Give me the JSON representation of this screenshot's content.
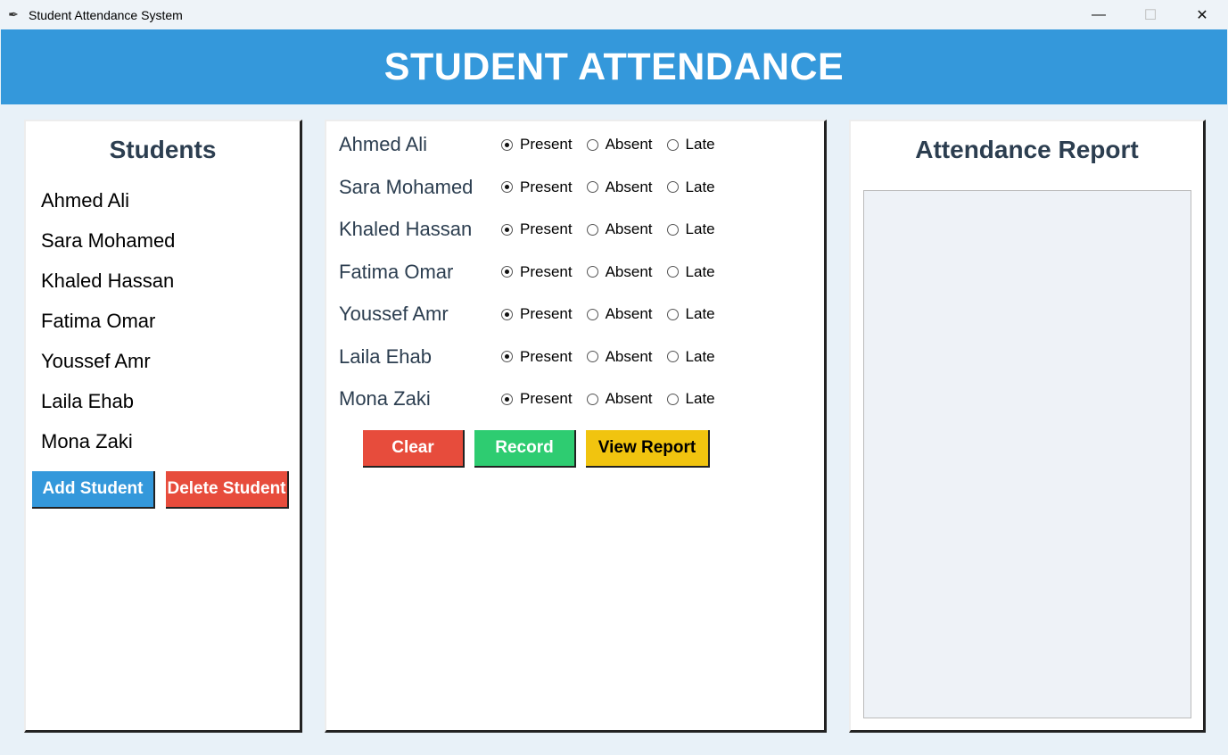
{
  "window": {
    "title": "Student Attendance System",
    "app_icon": "feather-icon",
    "controls": {
      "minimize": "—",
      "maximize": "☐",
      "close": "✕"
    }
  },
  "header": {
    "title": "STUDENT ATTENDANCE"
  },
  "students_panel": {
    "heading": "Students",
    "students": [
      "Ahmed Ali",
      "Sara Mohamed",
      "Khaled Hassan",
      "Fatima Omar",
      "Youssef Amr",
      "Laila Ehab",
      "Mona Zaki"
    ],
    "add_button": "Add Student",
    "delete_button": "Delete Student"
  },
  "attendance_panel": {
    "options": [
      "Present",
      "Absent",
      "Late"
    ],
    "rows": [
      {
        "name": "Ahmed Ali",
        "selected": "Present"
      },
      {
        "name": "Sara Mohamed",
        "selected": "Present"
      },
      {
        "name": "Khaled Hassan",
        "selected": "Present"
      },
      {
        "name": "Fatima Omar",
        "selected": "Present"
      },
      {
        "name": "Youssef Amr",
        "selected": "Present"
      },
      {
        "name": "Laila Ehab",
        "selected": "Present"
      },
      {
        "name": "Mona Zaki",
        "selected": "Present"
      }
    ],
    "clear_button": "Clear",
    "record_button": "Record",
    "view_report_button": "View Report"
  },
  "report_panel": {
    "heading": "Attendance Report",
    "content": ""
  },
  "colors": {
    "header_bg": "#3498db",
    "heading_text": "#2c3e50",
    "add_button": "#3498db",
    "delete_button": "#e74c3c",
    "clear_button": "#e74c3c",
    "record_button": "#2ecc71",
    "view_report_button": "#f1c40f"
  }
}
